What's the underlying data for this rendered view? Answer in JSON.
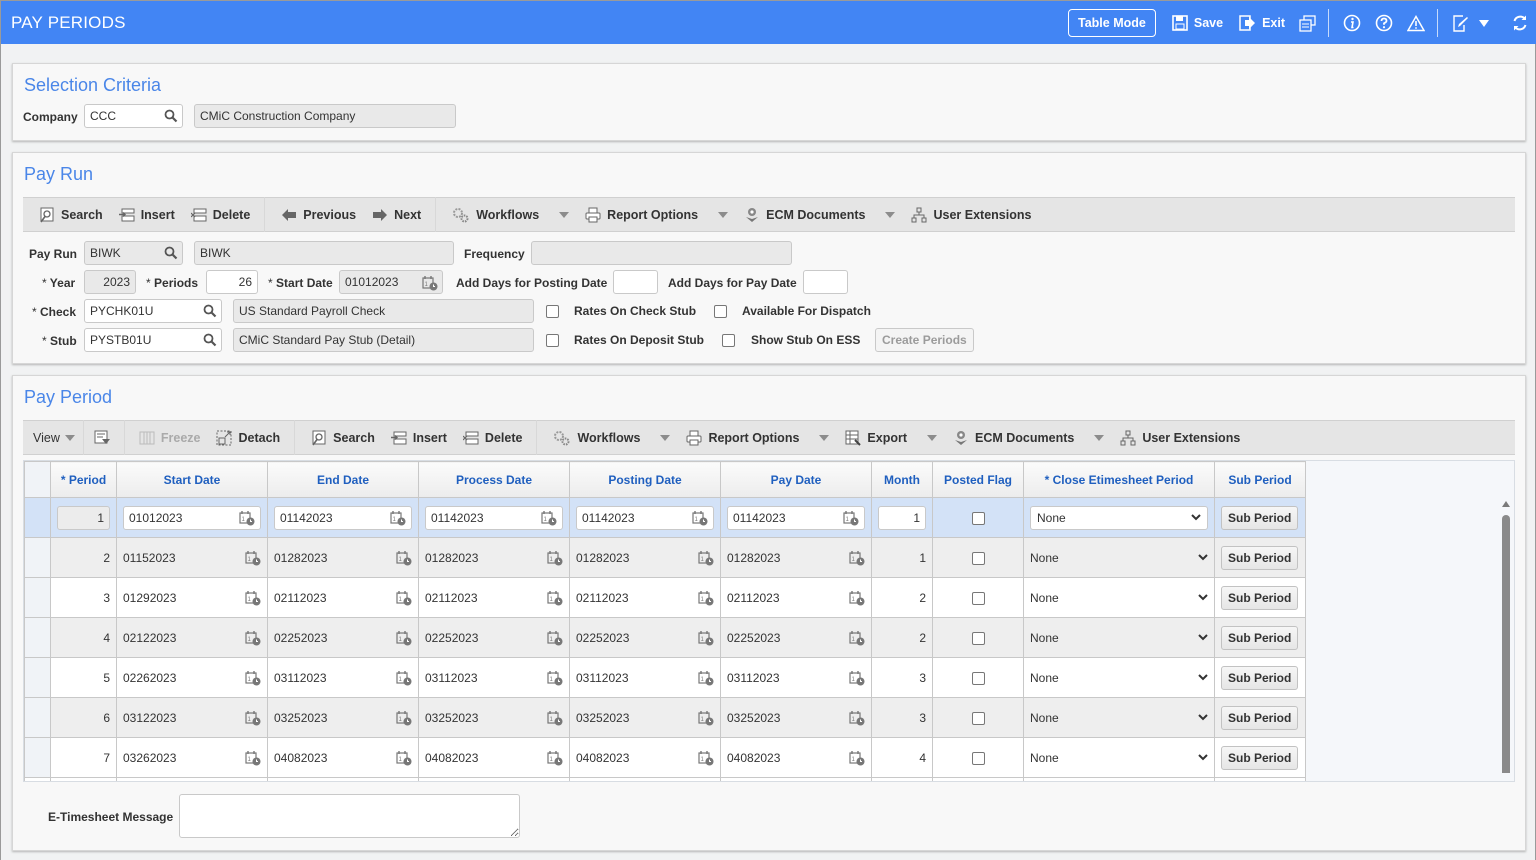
{
  "app": {
    "title": "PAY PERIODS",
    "table_mode": "Table Mode",
    "save": "Save",
    "exit": "Exit"
  },
  "colors": {
    "header_bg": "#4285f4",
    "section_title": "#4a86e8",
    "column_header": "#1f5fbf",
    "selected_row": "#d3e2f7"
  },
  "selection_criteria": {
    "title": "Selection Criteria",
    "company_label": "Company",
    "company_code": "CCC",
    "company_name": "CMiC Construction Company"
  },
  "pay_run": {
    "title": "Pay Run",
    "toolbar": {
      "search": "Search",
      "insert": "Insert",
      "delete": "Delete",
      "previous": "Previous",
      "next": "Next",
      "workflows": "Workflows",
      "report_options": "Report Options",
      "ecm_documents": "ECM Documents",
      "user_extensions": "User Extensions"
    },
    "pay_run_label": "Pay Run",
    "pay_run_code": "BIWK",
    "pay_run_name": "BIWK",
    "frequency_label": "Frequency",
    "frequency_value": "",
    "year_label": "Year",
    "year_value": "2023",
    "periods_label": "Periods",
    "periods_value": "26",
    "start_date_label": "Start Date",
    "start_date_value": "01012023",
    "add_days_posting_label": "Add Days for Posting Date",
    "add_days_posting_value": "",
    "add_days_pay_label": "Add Days for Pay Date",
    "add_days_pay_value": "",
    "check_label": "Check",
    "check_code": "PYCHK01U",
    "check_name": "US Standard Payroll Check",
    "stub_label": "Stub",
    "stub_code": "PYSTB01U",
    "stub_name": "CMiC Standard Pay Stub (Detail)",
    "rates_on_check_stub": "Rates On Check Stub",
    "available_for_dispatch": "Available For Dispatch",
    "rates_on_deposit_stub": "Rates On Deposit Stub",
    "show_stub_on_ess": "Show Stub On ESS",
    "create_periods": "Create Periods",
    "required_marker": "*"
  },
  "pay_period": {
    "title": "Pay Period",
    "toolbar": {
      "view": "View",
      "freeze": "Freeze",
      "detach": "Detach",
      "search": "Search",
      "insert": "Insert",
      "delete": "Delete",
      "workflows": "Workflows",
      "report_options": "Report Options",
      "export": "Export",
      "ecm_documents": "ECM Documents",
      "user_extensions": "User Extensions"
    },
    "columns": [
      "* Period",
      "Start Date",
      "End Date",
      "Process Date",
      "Posting Date",
      "Pay Date",
      "Month",
      "Posted Flag",
      "* Close Etimesheet Period",
      "Sub Period"
    ],
    "rows": [
      {
        "period": "1",
        "start": "01012023",
        "end": "01142023",
        "process": "01142023",
        "posting": "01142023",
        "pay": "01142023",
        "month": "1",
        "posted": false,
        "close": "None",
        "sub": "Sub Period"
      },
      {
        "period": "2",
        "start": "01152023",
        "end": "01282023",
        "process": "01282023",
        "posting": "01282023",
        "pay": "01282023",
        "month": "1",
        "posted": false,
        "close": "None",
        "sub": "Sub Period"
      },
      {
        "period": "3",
        "start": "01292023",
        "end": "02112023",
        "process": "02112023",
        "posting": "02112023",
        "pay": "02112023",
        "month": "2",
        "posted": false,
        "close": "None",
        "sub": "Sub Period"
      },
      {
        "period": "4",
        "start": "02122023",
        "end": "02252023",
        "process": "02252023",
        "posting": "02252023",
        "pay": "02252023",
        "month": "2",
        "posted": false,
        "close": "None",
        "sub": "Sub Period"
      },
      {
        "period": "5",
        "start": "02262023",
        "end": "03112023",
        "process": "03112023",
        "posting": "03112023",
        "pay": "03112023",
        "month": "3",
        "posted": false,
        "close": "None",
        "sub": "Sub Period"
      },
      {
        "period": "6",
        "start": "03122023",
        "end": "03252023",
        "process": "03252023",
        "posting": "03252023",
        "pay": "03252023",
        "month": "3",
        "posted": false,
        "close": "None",
        "sub": "Sub Period"
      },
      {
        "period": "7",
        "start": "03262023",
        "end": "04082023",
        "process": "04082023",
        "posting": "04082023",
        "pay": "04082023",
        "month": "4",
        "posted": false,
        "close": "None",
        "sub": "Sub Period"
      }
    ],
    "etimesheet_message_label": "E-Timesheet Message",
    "etimesheet_message_value": ""
  }
}
